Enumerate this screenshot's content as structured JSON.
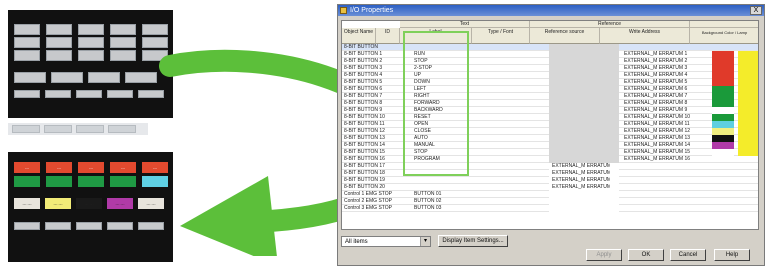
{
  "left_preview": {
    "top_grey_rows": 3,
    "bottom_red_labels": [
      "---",
      "---",
      "---",
      "---",
      "---"
    ],
    "bottom_mid_labels": [
      "--- ---",
      "--- ---",
      "--- ---",
      "--- ---",
      "--- ---"
    ]
  },
  "dialog": {
    "title": "I/O Properties",
    "close_label": "X",
    "group_headers": {
      "text": "Text",
      "reference": "Reference"
    },
    "column_headers": {
      "object_name": "Object Name",
      "id": "ID",
      "label": "Label",
      "type": "Type / Font",
      "reference_source": "Reference source",
      "write_address": "Write Address"
    },
    "color_header": "Background Color / Lamp",
    "rows": [
      {
        "name": "8-BIT BUTTON",
        "label": "",
        "ref": "",
        "addr": ""
      },
      {
        "name": "8-BIT BUTTON 1",
        "label": "RUN",
        "ref": "",
        "addr": "EXTERNAL_M ERRATUM 1"
      },
      {
        "name": "8-BIT BUTTON 2",
        "label": "STOP",
        "ref": "",
        "addr": "EXTERNAL_M ERRATUM 2"
      },
      {
        "name": "8-BIT BUTTON 3",
        "label": "2-STOP",
        "ref": "",
        "addr": "EXTERNAL_M ERRATUM 3"
      },
      {
        "name": "8-BIT BUTTON 4",
        "label": "UP",
        "ref": "",
        "addr": "EXTERNAL_M ERRATUM 4"
      },
      {
        "name": "8-BIT BUTTON 5",
        "label": "DOWN",
        "ref": "",
        "addr": "EXTERNAL_M ERRATUM 5"
      },
      {
        "name": "8-BIT BUTTON 6",
        "label": "LEFT",
        "ref": "",
        "addr": "EXTERNAL_M ERRATUM 6"
      },
      {
        "name": "8-BIT BUTTON 7",
        "label": "RIGHT",
        "ref": "",
        "addr": "EXTERNAL_M ERRATUM 7"
      },
      {
        "name": "8-BIT BUTTON 8",
        "label": "FORWARD",
        "ref": "",
        "addr": "EXTERNAL_M ERRATUM 8"
      },
      {
        "name": "8-BIT BUTTON 9",
        "label": "BACKWARD",
        "ref": "",
        "addr": "EXTERNAL_M ERRATUM 9"
      },
      {
        "name": "8-BIT BUTTON 10",
        "label": "RESET",
        "ref": "",
        "addr": "EXTERNAL_M ERRATUM 10"
      },
      {
        "name": "8-BIT BUTTON 11",
        "label": "OPEN",
        "ref": "",
        "addr": "EXTERNAL_M ERRATUM 11"
      },
      {
        "name": "8-BIT BUTTON 12",
        "label": "CLOSE",
        "ref": "",
        "addr": "EXTERNAL_M ERRATUM 12"
      },
      {
        "name": "8-BIT BUTTON 13",
        "label": "AUTO",
        "ref": "",
        "addr": "EXTERNAL_M ERRATUM 13"
      },
      {
        "name": "8-BIT BUTTON 14",
        "label": "MANUAL",
        "ref": "",
        "addr": "EXTERNAL_M ERRATUM 14"
      },
      {
        "name": "8-BIT BUTTON 15",
        "label": "STOP",
        "ref": "",
        "addr": "EXTERNAL_M ERRATUM 15"
      },
      {
        "name": "8-BIT BUTTON 16",
        "label": "PROGRAM",
        "ref": "",
        "addr": "EXTERNAL_M ERRATUM 16"
      },
      {
        "name": "8-BIT BUTTON 17",
        "label": "",
        "ref": "EXTERNAL_M ERRATUM",
        "addr": ""
      },
      {
        "name": "8-BIT BUTTON 18",
        "label": "",
        "ref": "EXTERNAL_M ERRATUM",
        "addr": ""
      },
      {
        "name": "8-BIT BUTTON 19",
        "label": "",
        "ref": "EXTERNAL_M ERRATUM",
        "addr": ""
      },
      {
        "name": "8-BIT BUTTON 20",
        "label": "",
        "ref": "EXTERNAL_M ERRATUM",
        "addr": ""
      },
      {
        "name": "Control 1 EMG STOP",
        "label": "BUTTON 01",
        "ref": "",
        "addr": ""
      },
      {
        "name": "Control 2 EMG STOP",
        "label": "BUTTON 02",
        "ref": "",
        "addr": ""
      },
      {
        "name": "Control 3 EMG STOP",
        "label": "BUTTON 03",
        "ref": "",
        "addr": ""
      }
    ],
    "row_colors": [
      [
        "",
        "",
        ""
      ],
      [
        "#e03a2a",
        "#f4ec2a",
        ""
      ],
      [
        "#e03a2a",
        "#f4ec2a",
        ""
      ],
      [
        "#e03a2a",
        "#f4ec2a",
        ""
      ],
      [
        "#e03a2a",
        "#f4ec2a",
        ""
      ],
      [
        "#e03a2a",
        "#f4ec2a",
        ""
      ],
      [
        "#1a9a3a",
        "#f4ec2a",
        ""
      ],
      [
        "#1a9a3a",
        "#f4ec2a",
        ""
      ],
      [
        "#1a9a3a",
        "#f4ec2a",
        ""
      ],
      [
        "#ffffff",
        "#f4ec2a",
        ""
      ],
      [
        "#1a9a3a",
        "#f4ec2a",
        ""
      ],
      [
        "#5ecfe0",
        "#f4ec2a",
        ""
      ],
      [
        "#f0ee80",
        "#f4ec2a",
        ""
      ],
      [
        "#111111",
        "#f4ec2a",
        ""
      ],
      [
        "#b03aa8",
        "#f4ec2a",
        ""
      ],
      [
        "#ffffff",
        "#f4ec2a",
        ""
      ]
    ],
    "filter": {
      "value": "All items",
      "button_label": "Display Item Settings..."
    },
    "buttons": {
      "apply": "Apply",
      "ok": "OK",
      "cancel": "Cancel",
      "help": "Help"
    }
  }
}
